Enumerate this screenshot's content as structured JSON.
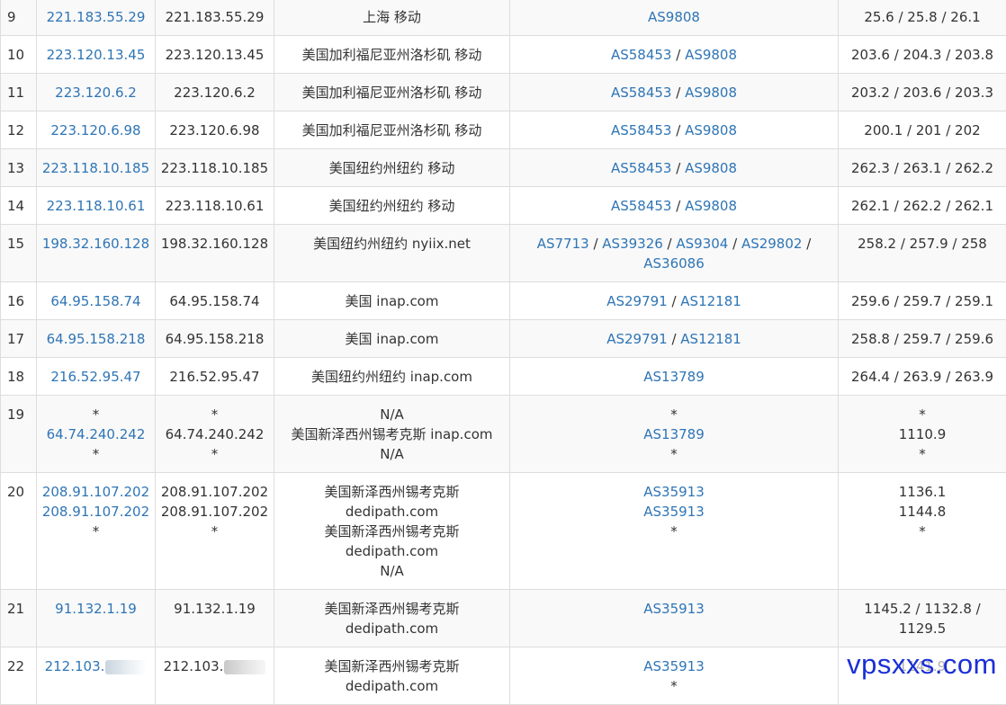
{
  "colors": {
    "link": "#2f75b5",
    "border": "#dddddd",
    "row_alt": "#f9f9f9",
    "watermark": "#1a2fd6"
  },
  "rows": [
    {
      "hop": "9",
      "ip": [
        "221.183.55.29"
      ],
      "host": [
        "221.183.55.29"
      ],
      "loc": [
        "上海 移动"
      ],
      "asn": [
        [
          "AS9808"
        ]
      ],
      "rtt": [
        "25.6 / 25.8 / 26.1"
      ]
    },
    {
      "hop": "10",
      "ip": [
        "223.120.13.45"
      ],
      "host": [
        "223.120.13.45"
      ],
      "loc": [
        "美国加利福尼亚州洛杉矶 移动"
      ],
      "asn": [
        [
          "AS58453",
          "AS9808"
        ]
      ],
      "rtt": [
        "203.6 / 204.3 / 203.8"
      ]
    },
    {
      "hop": "11",
      "ip": [
        "223.120.6.2"
      ],
      "host": [
        "223.120.6.2"
      ],
      "loc": [
        "美国加利福尼亚州洛杉矶 移动"
      ],
      "asn": [
        [
          "AS58453",
          "AS9808"
        ]
      ],
      "rtt": [
        "203.2 / 203.6 / 203.3"
      ]
    },
    {
      "hop": "12",
      "ip": [
        "223.120.6.98"
      ],
      "host": [
        "223.120.6.98"
      ],
      "loc": [
        "美国加利福尼亚州洛杉矶 移动"
      ],
      "asn": [
        [
          "AS58453",
          "AS9808"
        ]
      ],
      "rtt": [
        "200.1 / 201 / 202"
      ]
    },
    {
      "hop": "13",
      "ip": [
        "223.118.10.185"
      ],
      "host": [
        "223.118.10.185"
      ],
      "loc": [
        "美国纽约州纽约 移动"
      ],
      "asn": [
        [
          "AS58453",
          "AS9808"
        ]
      ],
      "rtt": [
        "262.3 / 263.1 / 262.2"
      ]
    },
    {
      "hop": "14",
      "ip": [
        "223.118.10.61"
      ],
      "host": [
        "223.118.10.61"
      ],
      "loc": [
        "美国纽约州纽约 移动"
      ],
      "asn": [
        [
          "AS58453",
          "AS9808"
        ]
      ],
      "rtt": [
        "262.1 / 262.2 / 262.1"
      ]
    },
    {
      "hop": "15",
      "ip": [
        "198.32.160.128"
      ],
      "host": [
        "198.32.160.128"
      ],
      "loc": [
        "美国纽约州纽约 nyiix.net"
      ],
      "asn": [
        [
          "AS7713",
          "AS39326",
          "AS9304",
          "AS29802",
          ""
        ],
        [
          "AS36086"
        ]
      ],
      "rtt": [
        "258.2 / 257.9 / 258"
      ]
    },
    {
      "hop": "16",
      "ip": [
        "64.95.158.74"
      ],
      "host": [
        "64.95.158.74"
      ],
      "loc": [
        "美国 inap.com"
      ],
      "asn": [
        [
          "AS29791",
          "AS12181"
        ]
      ],
      "rtt": [
        "259.6 / 259.7 / 259.1"
      ]
    },
    {
      "hop": "17",
      "ip": [
        "64.95.158.218"
      ],
      "host": [
        "64.95.158.218"
      ],
      "loc": [
        "美国 inap.com"
      ],
      "asn": [
        [
          "AS29791",
          "AS12181"
        ]
      ],
      "rtt": [
        "258.8 / 259.7 / 259.6"
      ]
    },
    {
      "hop": "18",
      "ip": [
        "216.52.95.47"
      ],
      "host": [
        "216.52.95.47"
      ],
      "loc": [
        "美国纽约州纽约 inap.com"
      ],
      "asn": [
        [
          "AS13789"
        ]
      ],
      "rtt": [
        "264.4 / 263.9 / 263.9"
      ]
    },
    {
      "hop": "19",
      "ip": [
        "*",
        "64.74.240.242",
        "*"
      ],
      "host": [
        "*",
        "64.74.240.242",
        "*"
      ],
      "loc": [
        "N/A",
        "美国新泽西州锡考克斯 inap.com",
        "N/A"
      ],
      "asn": [
        [
          "*"
        ],
        [
          "AS13789"
        ],
        [
          "*"
        ]
      ],
      "rtt": [
        "*",
        "1110.9",
        "*"
      ]
    },
    {
      "hop": "20",
      "ip": [
        "208.91.107.202",
        "208.91.107.202",
        "*"
      ],
      "host": [
        "208.91.107.202",
        "208.91.107.202",
        "*"
      ],
      "loc": [
        "美国新泽西州锡考克斯",
        "dedipath.com",
        "美国新泽西州锡考克斯",
        "dedipath.com",
        "N/A"
      ],
      "asn": [
        [
          "AS35913"
        ],
        [
          "AS35913"
        ],
        [
          "*"
        ]
      ],
      "rtt": [
        "1136.1",
        "1144.8",
        "*"
      ]
    },
    {
      "hop": "21",
      "ip": [
        "91.132.1.19"
      ],
      "host": [
        "91.132.1.19"
      ],
      "loc": [
        "美国新泽西州锡考克斯",
        "dedipath.com"
      ],
      "asn": [
        [
          "AS35913"
        ]
      ],
      "rtt": [
        "1145.2 / 1132.8 /",
        "1129.5"
      ]
    },
    {
      "hop": "22",
      "ip": [
        "212.103."
      ],
      "host": [
        "212.103."
      ],
      "loc": [
        "美国新泽西州锡考克斯",
        "dedipath.com"
      ],
      "asn": [
        [
          "AS35913"
        ],
        [
          "*"
        ]
      ],
      "rtt": [
        "1141.9"
      ]
    }
  ],
  "watermark": "vpsxxs.com"
}
